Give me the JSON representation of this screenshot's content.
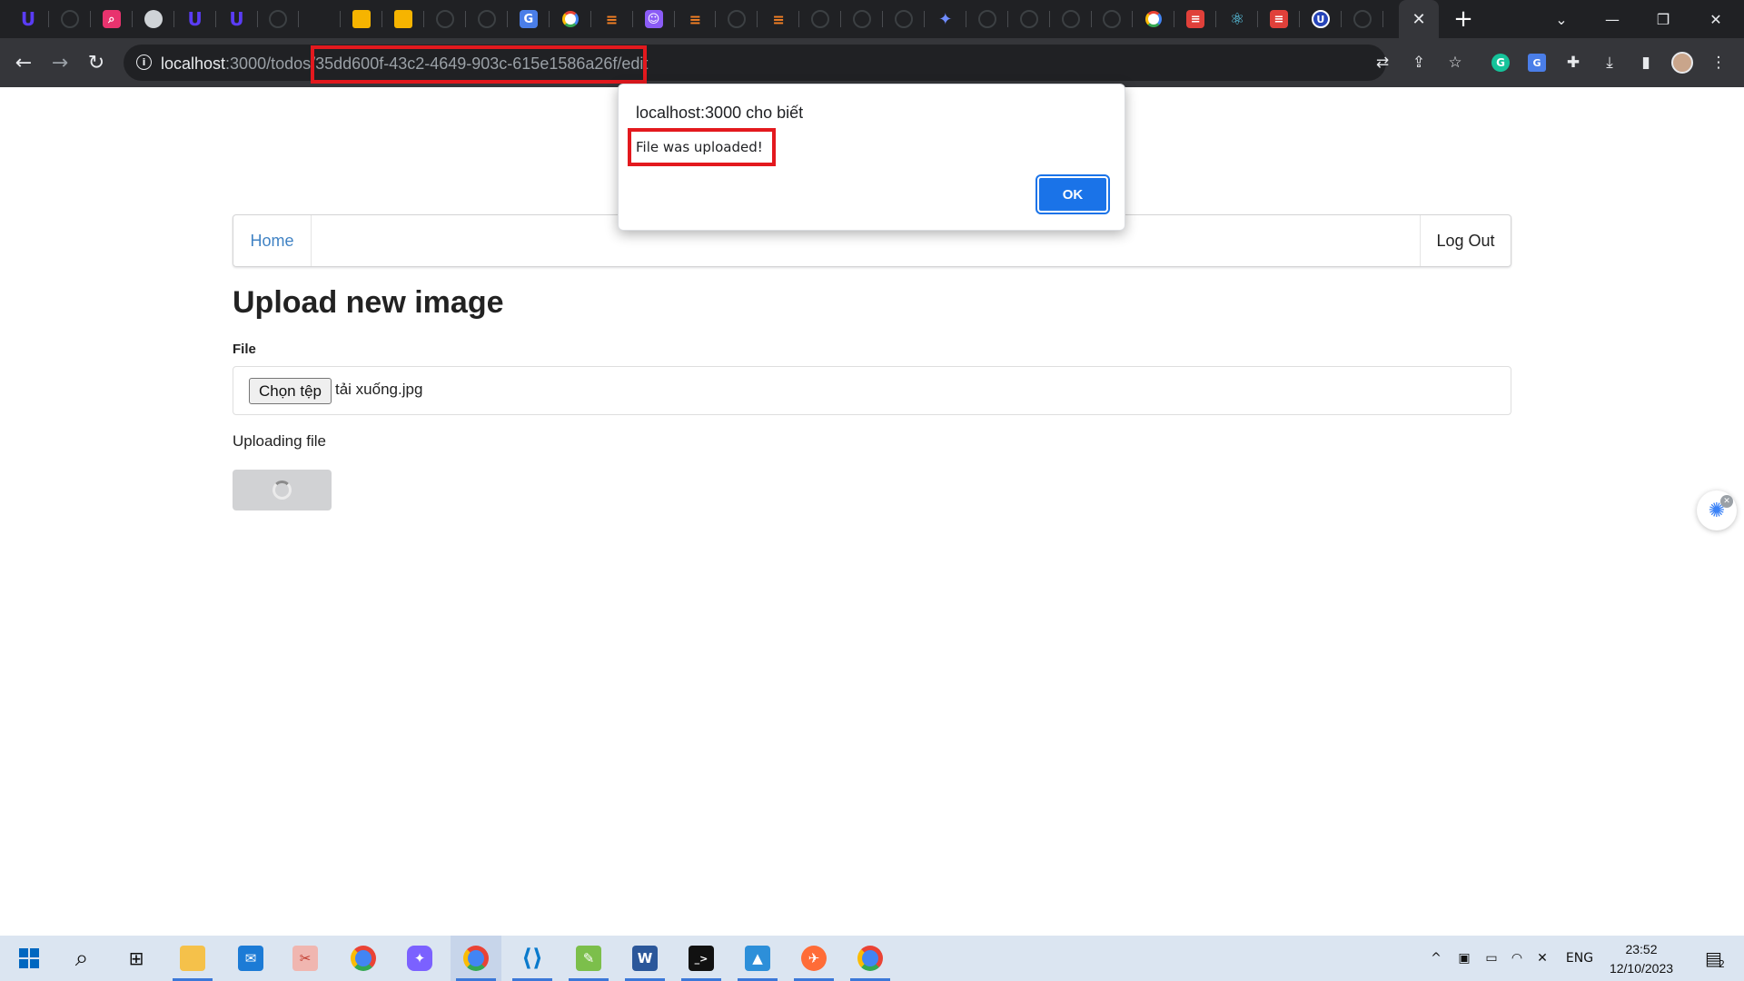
{
  "browser": {
    "tabs": [
      {
        "icon": "udemy-icon"
      },
      {
        "icon": "github-icon"
      },
      {
        "icon": "search-app-icon"
      },
      {
        "icon": "globe-icon"
      },
      {
        "icon": "udemy-icon"
      },
      {
        "icon": "udemy-icon"
      },
      {
        "icon": "shield-icon"
      },
      {
        "icon": "blank-icon"
      },
      {
        "icon": "box-icon"
      },
      {
        "icon": "box-icon"
      },
      {
        "icon": "github-icon"
      },
      {
        "icon": "github-icon"
      },
      {
        "icon": "translate-icon"
      },
      {
        "icon": "google-icon"
      },
      {
        "icon": "stackoverflow-icon"
      },
      {
        "icon": "discord-icon"
      },
      {
        "icon": "stackoverflow-icon"
      },
      {
        "icon": "github-icon"
      },
      {
        "icon": "stackoverflow-icon"
      },
      {
        "icon": "github-icon"
      },
      {
        "icon": "github-icon"
      },
      {
        "icon": "github-icon"
      },
      {
        "icon": "sparkle-icon"
      },
      {
        "icon": "github-icon"
      },
      {
        "icon": "github-icon"
      },
      {
        "icon": "github-icon"
      },
      {
        "icon": "github-icon"
      },
      {
        "icon": "google-icon"
      },
      {
        "icon": "list-icon"
      },
      {
        "icon": "react-icon"
      },
      {
        "icon": "list-icon"
      },
      {
        "icon": "udemy-circle-icon"
      },
      {
        "icon": "github-icon"
      }
    ],
    "active_tab_close": "✕",
    "new_tab": "+",
    "url_host": "localhost",
    "url_rest": ":3000/todos/35dd600f-43c2-4649-903c-615e1586a26f/edit"
  },
  "nav": {
    "home_label": "Home",
    "logout_label": "Log Out"
  },
  "main": {
    "title": "Upload new image",
    "file_label": "File",
    "choose_button": "Chọn tệp",
    "file_name": "tải xuống.jpg",
    "status": "Uploading file"
  },
  "dialog": {
    "title": "localhost:3000 cho biết",
    "message": "File was uploaded!",
    "ok_label": "OK"
  },
  "taskbar": {
    "language": "ENG",
    "time": "23:52",
    "date": "12/10/2023",
    "notification_count": "2"
  },
  "colors": {
    "accent": "#1a73e8",
    "highlight": "#e3191e",
    "link": "#4183c4"
  }
}
